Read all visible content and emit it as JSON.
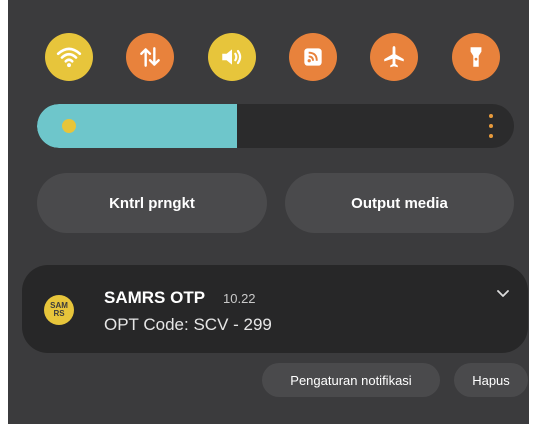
{
  "quick_settings": [
    {
      "name": "wifi-icon",
      "color": "#e7c53b"
    },
    {
      "name": "mobile-data-icon",
      "color": "#e8823c"
    },
    {
      "name": "sound-icon",
      "color": "#e7c53b"
    },
    {
      "name": "cast-icon",
      "color": "#e8823c"
    },
    {
      "name": "airplane-mode-icon",
      "color": "#e8823c"
    },
    {
      "name": "flashlight-icon",
      "color": "#e8823c"
    }
  ],
  "brightness": {
    "level": 0.42,
    "fill_color": "#6ec6cb"
  },
  "buttons": {
    "device_control": "Kntrl prngkt",
    "media_output": "Output media"
  },
  "notification": {
    "app_name": "SAMRS OTP",
    "time": "10.22",
    "body": "OPT Code: SCV - 299",
    "avatar_text": "SAM RS"
  },
  "actions": {
    "settings": "Pengaturan notifikasi",
    "clear": "Hapus"
  }
}
